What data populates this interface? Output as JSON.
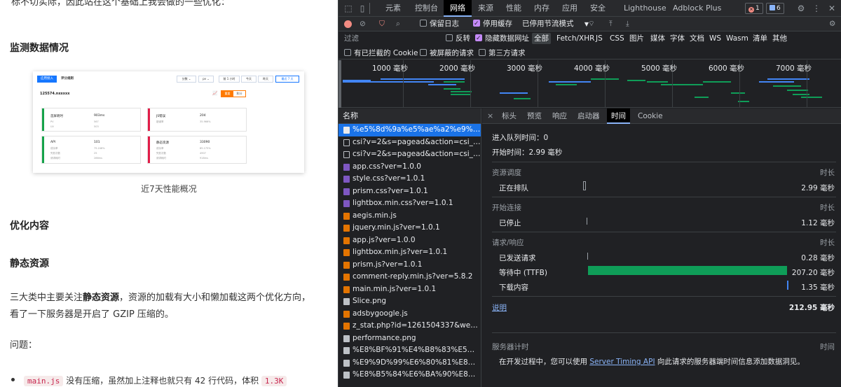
{
  "article": {
    "cut_text": "标不切实际，因此站在这个基础上我会做的一些优化：",
    "h_monitor": "监测数据情况",
    "caption": "近7天性能概况",
    "h_optimize": "优化内容",
    "h_static": "静态资源",
    "para1_a": "三大类中主要关注",
    "para1_b": "静态资源",
    "para1_c": "，资源的加载有大小和懒加载这两个优化方向，",
    "para2": "看了一下服务器是开启了 GZIP 压缩的。",
    "question": "问题：",
    "li_code": "main.js",
    "li_text": "没有压缩，虽然加上注释也就只有 42 行代码，体积",
    "li_code2": "1.3K",
    "thumb": {
      "tab_active": "应用接入",
      "tab_other": "评分规则",
      "ctl1": "分数",
      "ctl1_arrow": "⌄",
      "ctl2": "pv",
      "ctl2_arrow": "⌄",
      "ctl3": "前 1 小时",
      "ctl4": "今天",
      "ctl5": "昨天",
      "ctl6": "最近 7 天",
      "site": "125574.nxxxxx",
      "btn_on": "重要",
      "btn_off": "和分",
      "cards": [
        {
          "k": "首屏耗时",
          "v": "903ms",
          "s1k": "PV",
          "s1v": "567",
          "s2k": "UV",
          "s2v": "503"
        },
        {
          "k": "JS错误",
          "v": "204",
          "s1k": "错误率",
          "s1v": "35.966%",
          "s2k": "",
          "s2v": ""
        },
        {
          "k": "API",
          "v": "101",
          "s1k": "成功率",
          "s1v": "75.248%",
          "s2k": "失败次数",
          "s2v": "25",
          "s3k": "请求耗时",
          "s3v": "286ms"
        },
        {
          "k": "静态资源",
          "v": "33090",
          "s1k": "成功率",
          "s1v": "85.175%",
          "s2k": "失败次数",
          "s2v": "4907",
          "s3k": "请求耗时",
          "s3v": "918ms"
        }
      ],
      "colors": {
        "green": "#16a34a",
        "red": "#e11d48",
        "blue": "#1677ff",
        "orange": "#ff7a00"
      }
    }
  },
  "devtools": {
    "tabs": [
      "元素",
      "控制台",
      "网络",
      "来源",
      "性能",
      "内存",
      "应用",
      "安全",
      "Lighthouse",
      "Adblock Plus"
    ],
    "active_tab": "网络",
    "errors": "1",
    "messages": "6",
    "toolbar": {
      "preserve_log": "保留日志",
      "disable_cache": "停用缓存",
      "throttle": "已停用节流模式",
      "dropdown_arrow": "▼"
    },
    "filter": {
      "placeholder": "过滤",
      "invert": "反转",
      "hide_data_urls": "隐藏数据网址",
      "types": [
        "全部",
        "Fetch/XHR",
        "JS",
        "CSS",
        "图片",
        "媒体",
        "字体",
        "文档",
        "WS",
        "Wasm",
        "清单",
        "其他"
      ],
      "active_type": "全部",
      "blocked_cookies": "有已拦截的 Cookie",
      "blocked_requests": "被屏蔽的请求",
      "third_party": "第三方请求"
    },
    "overview_ticks": [
      "1000 毫秒",
      "2000 毫秒",
      "3000 毫秒",
      "4000 毫秒",
      "5000 毫秒",
      "6000 毫秒",
      "7000 毫秒"
    ],
    "request_list": {
      "header": "名称",
      "rows": [
        {
          "name": "%e5%8d%9a%e5%ae%a2%e9%a...",
          "type": "doc",
          "selected": true
        },
        {
          "name": "csi?v=2&s=pagead&action=csi_page...",
          "type": "plain"
        },
        {
          "name": "csi?v=2&s=pagead&action=csi_page...",
          "type": "plain"
        },
        {
          "name": "app.css?ver=1.0.0",
          "type": "css"
        },
        {
          "name": "style.css?ver=1.0.1",
          "type": "css"
        },
        {
          "name": "prism.css?ver=1.0.1",
          "type": "css"
        },
        {
          "name": "lightbox.min.css?ver=1.0.1",
          "type": "css"
        },
        {
          "name": "aegis.min.js",
          "type": "js"
        },
        {
          "name": "jquery.min.js?ver=1.0.1",
          "type": "js"
        },
        {
          "name": "app.js?ver=1.0.0",
          "type": "js"
        },
        {
          "name": "lightbox.min.js?ver=1.0.1",
          "type": "js"
        },
        {
          "name": "prism.js?ver=1.0.1",
          "type": "js"
        },
        {
          "name": "comment-reply.min.js?ver=5.8.2",
          "type": "js"
        },
        {
          "name": "main.min.js?ver=1.0.1",
          "type": "js"
        },
        {
          "name": "Slice.png",
          "type": "img"
        },
        {
          "name": "adsbygoogle.js",
          "type": "js"
        },
        {
          "name": "z_stat.php?id=1261504337&web_id=...",
          "type": "js"
        },
        {
          "name": "performance.png",
          "type": "img"
        },
        {
          "name": "%E8%BF%91%E4%B8%83%E5%...",
          "type": "img"
        },
        {
          "name": "%E9%9D%99%E6%80%81%E8%...",
          "type": "img"
        },
        {
          "name": "%E8%B5%84%E6%BA%90%E8%...",
          "type": "img"
        }
      ]
    },
    "detail": {
      "close": "×",
      "tabs": [
        "标头",
        "预览",
        "响应",
        "启动器",
        "时间",
        "Cookie"
      ],
      "active_tab": "时间",
      "queued_at": "进入队列时间：0",
      "started_at": "开始时间：2.99 毫秒",
      "duration_label": "时长",
      "resource_scheduling": "资源调度",
      "queueing": "正在排队",
      "queueing_val": "2.99 毫秒",
      "connection_start": "开始连接",
      "stalled": "已停止",
      "stalled_val": "1.12 毫秒",
      "request_response": "请求/响应",
      "request_sent": "已发送请求",
      "request_sent_val": "0.28 毫秒",
      "waiting": "等待中 (TTFB)",
      "waiting_val": "207.20 毫秒",
      "download": "下载内容",
      "download_val": "1.35 毫秒",
      "explanation": "说明",
      "total": "212.95 毫秒",
      "server_timing": "服务器计时",
      "time_label": "时间",
      "server_note_a": "在开发过程中，您可以使用 ",
      "server_note_link": "Server Timing API",
      "server_note_b": " 向此请求的服务器端时间信息添加数据洞见。"
    },
    "colors": {
      "accent": "#8ab4f8",
      "selected_row": "#1a73e8",
      "ttfb": "#0f9d58",
      "download": "#4285f4"
    }
  }
}
